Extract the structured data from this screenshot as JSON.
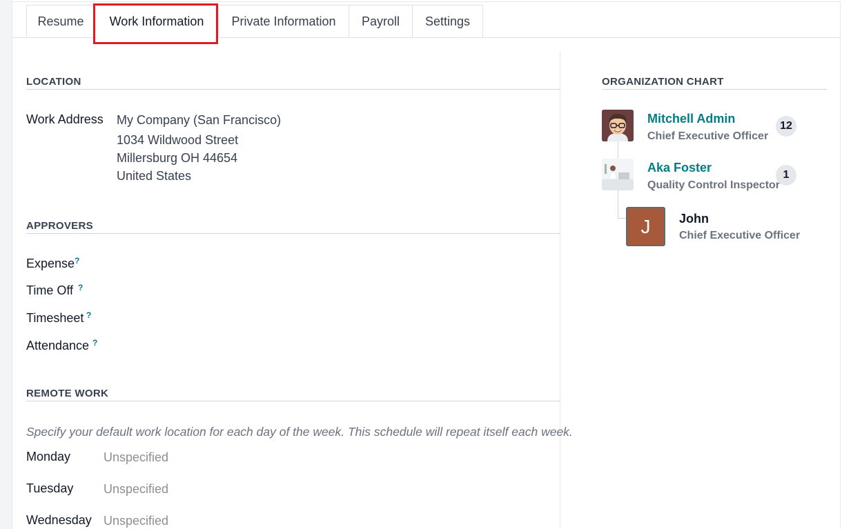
{
  "tabs": [
    "Resume",
    "Work Information",
    "Private Information",
    "Payroll",
    "Settings"
  ],
  "location": {
    "title": "LOCATION",
    "work_address_label": "Work Address",
    "address_lines": [
      "My Company (San Francisco)",
      "1034 Wildwood Street",
      "Millersburg OH 44654",
      "United States"
    ]
  },
  "approvers": {
    "title": "APPROVERS",
    "fields": [
      "Expense",
      "Time Off",
      "Timesheet",
      "Attendance"
    ],
    "help_mark": "?"
  },
  "remote_work": {
    "title": "REMOTE WORK",
    "note": "Specify your default work location for each day of the week. This schedule will repeat itself each week.",
    "days": [
      {
        "day": "Monday",
        "value": "Unspecified"
      },
      {
        "day": "Tuesday",
        "value": "Unspecified"
      },
      {
        "day": "Wednesday",
        "value": "Unspecified"
      }
    ]
  },
  "org_chart": {
    "title": "ORGANIZATION CHART",
    "people": [
      {
        "name": "Mitchell Admin",
        "job": "Chief Executive Officer",
        "count": "12"
      },
      {
        "name": "Aka Foster",
        "job": "Quality Control Inspector",
        "count": "1"
      }
    ],
    "current": {
      "initial": "J",
      "name": "John",
      "job": "Chief Executive Officer"
    }
  },
  "colors": {
    "accent": "#017e84",
    "highlight": "#e01b24",
    "john_avatar": "#a65a3b"
  }
}
